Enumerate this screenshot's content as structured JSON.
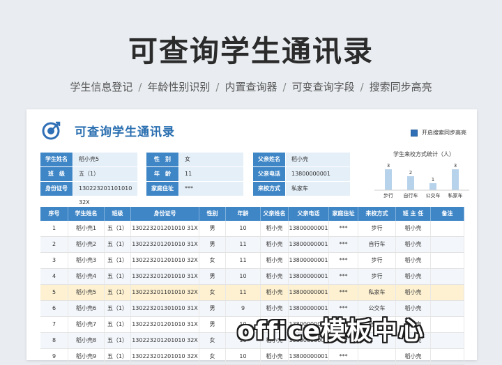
{
  "hero_title": "可查询学生通讯录",
  "features": [
    "学生信息登记",
    "年龄性别识别",
    "内置查询器",
    "可变查询字段",
    "搜索同步高亮"
  ],
  "feature_separator": "/",
  "sheet": {
    "title": "可查询学生通讯录",
    "sync_checkbox_label": "开启搜索同步高亮",
    "sync_checked": true,
    "accent_color": "#3f86c7"
  },
  "form": {
    "student_name": {
      "label": "学生姓名",
      "value": "稻小壳5"
    },
    "class": {
      "label": "班　级",
      "value": "五（1）"
    },
    "id_card": {
      "label": "身份证号",
      "value": "130223201101010 32X"
    },
    "gender": {
      "label": "性　别",
      "value": "女"
    },
    "age": {
      "label": "年　龄",
      "value": "11"
    },
    "address": {
      "label": "家庭住址",
      "value": "***"
    },
    "father_name": {
      "label": "父亲姓名",
      "value": "稻小壳"
    },
    "father_phone": {
      "label": "父亲电话",
      "value": "13800000001"
    },
    "transport": {
      "label": "来校方式",
      "value": "私家车"
    }
  },
  "chart_data": {
    "type": "bar",
    "title": "学生来校方式统计（人）",
    "categories": [
      "步行",
      "自行车",
      "公交车",
      "私家车"
    ],
    "values": [
      3,
      2,
      1,
      3
    ],
    "ylim": [
      0,
      3
    ],
    "bar_color": "#b7d3ec"
  },
  "table": {
    "headers": [
      "序号",
      "学生姓名",
      "班级",
      "身份证号",
      "性别",
      "年龄",
      "父亲姓名",
      "父亲电话",
      "家庭住址",
      "来校方式",
      "班 主 任",
      "备注"
    ],
    "rows": [
      [
        "1",
        "稻小壳1",
        "五（1）",
        "130223201201010 31X",
        "男",
        "10",
        "稻小壳",
        "13800000001",
        "***",
        "步行",
        "稻小壳",
        ""
      ],
      [
        "2",
        "稻小壳2",
        "五（1）",
        "130223201201010 31X",
        "男",
        "11",
        "稻小壳",
        "13800000001",
        "***",
        "自行车",
        "稻小壳",
        ""
      ],
      [
        "3",
        "稻小壳3",
        "五（1）",
        "130223201201010 32X",
        "女",
        "11",
        "稻小壳",
        "13800000001",
        "***",
        "步行",
        "稻小壳",
        ""
      ],
      [
        "4",
        "稻小壳4",
        "五（1）",
        "130223201201010 31X",
        "男",
        "10",
        "稻小壳",
        "13800000001",
        "***",
        "步行",
        "稻小壳",
        ""
      ],
      [
        "5",
        "稻小壳5",
        "五（1）",
        "130223201101010 32X",
        "女",
        "11",
        "稻小壳",
        "13800000001",
        "***",
        "私家车",
        "稻小壳",
        ""
      ],
      [
        "6",
        "稻小壳6",
        "五（1）",
        "130223201301010 31X",
        "男",
        "9",
        "稻小壳",
        "13800000001",
        "***",
        "公交车",
        "稻小壳",
        ""
      ],
      [
        "7",
        "稻小壳7",
        "五（1）",
        "130223201201010 31X",
        "男",
        "10",
        "稻小壳",
        "13800000001",
        "***",
        "自行车",
        "稻小壳",
        ""
      ],
      [
        "8",
        "稻小壳8",
        "五（1）",
        "130223201201010 32X",
        "女",
        "10",
        "稻小壳",
        "13800000001",
        "***",
        "",
        "稻小壳",
        ""
      ],
      [
        "9",
        "稻小壳9",
        "五（1）",
        "130223201201010 32X",
        "女",
        "10",
        "稻小壳",
        "13800000001",
        "***",
        "",
        "稻小壳",
        ""
      ]
    ],
    "highlighted_row": 5
  },
  "watermark": "office模板中心"
}
